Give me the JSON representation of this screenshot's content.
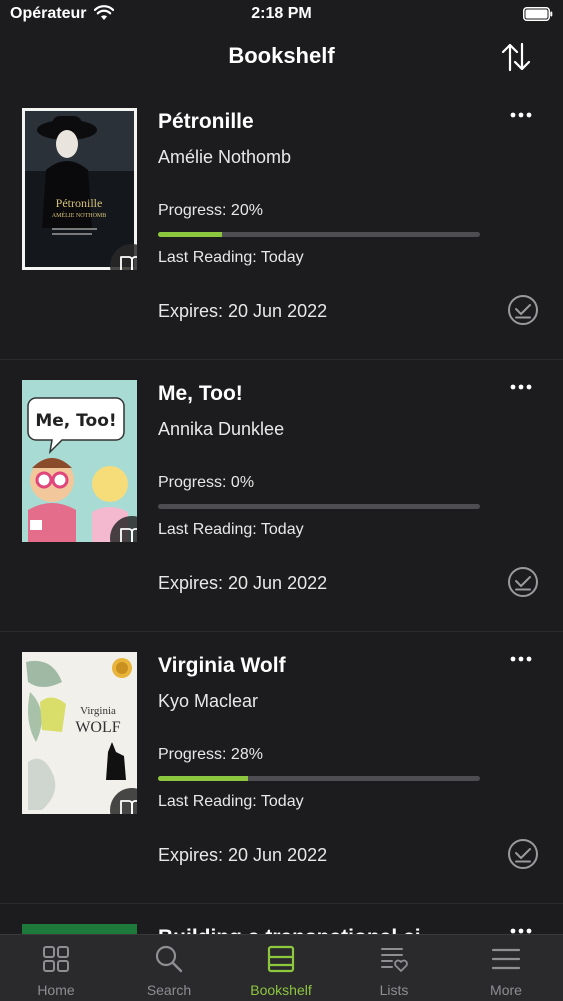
{
  "status_bar": {
    "carrier": "Opérateur",
    "time": "2:18 PM"
  },
  "header": {
    "title": "Bookshelf",
    "sort_icon": "sort-arrows-icon"
  },
  "books": [
    {
      "title": "Pétronille",
      "author": "Amélie Nothomb",
      "progress_label": "Progress: 20%",
      "progress": 0.2,
      "last_reading": "Last Reading: Today",
      "expires": "Expires: 20 Jun 2022",
      "cover_text": [
        "Pétronille",
        "AMÉLIE NOTHOMB"
      ]
    },
    {
      "title": "Me, Too!",
      "author": "Annika Dunklee",
      "progress_label": "Progress: 0%",
      "progress": 0.0,
      "last_reading": "Last Reading: Today",
      "expires": "Expires: 20 Jun 2022",
      "cover_text": [
        "Me, Too!"
      ]
    },
    {
      "title": "Virginia Wolf",
      "author": "Kyo Maclear",
      "progress_label": "Progress: 28%",
      "progress": 0.28,
      "last_reading": "Last Reading: Today",
      "expires": "Expires: 20 Jun 2022",
      "cover_text": [
        "Virginia",
        "WOLF"
      ]
    }
  ],
  "partial_book": {
    "title": "Building a transnational ci"
  },
  "tabs": [
    {
      "label": "Home",
      "icon": "grid-icon",
      "active": false
    },
    {
      "label": "Search",
      "icon": "search-icon",
      "active": false
    },
    {
      "label": "Bookshelf",
      "icon": "bookshelf-icon",
      "active": true
    },
    {
      "label": "Lists",
      "icon": "list-heart-icon",
      "active": false
    },
    {
      "label": "More",
      "icon": "menu-icon",
      "active": false
    }
  ],
  "colors": {
    "accent": "#8dc63f",
    "background": "#1c1c1e",
    "tab_bar": "#2a2a2c"
  }
}
